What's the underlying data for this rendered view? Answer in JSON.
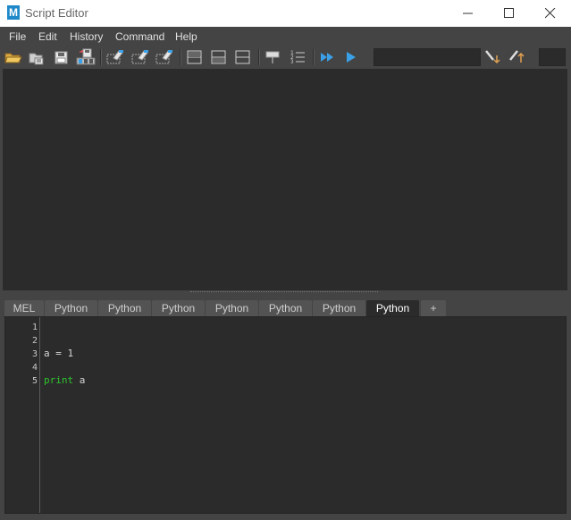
{
  "window": {
    "title": "Script Editor",
    "app_icon_letter": "M"
  },
  "menu": {
    "items": [
      "File",
      "Edit",
      "History",
      "Command",
      "Help"
    ]
  },
  "toolbar": {
    "icons": [
      "open-script-icon",
      "source-script-icon",
      "save-script-icon",
      "save-to-shelf-icon",
      "clear-history-icon",
      "clear-input-icon",
      "clear-all-icon",
      "show-history-only-icon",
      "show-input-only-icon",
      "show-both-icon",
      "echo-all-commands-icon",
      "show-line-numbers-icon",
      "execute-all-icon",
      "execute-icon",
      "search-down-icon",
      "search-up-icon"
    ],
    "command_value": "",
    "colors": {
      "accent": "#1e88c8",
      "play": "#3aa0e8",
      "search": "#e0a050"
    }
  },
  "tabs": [
    {
      "label": "MEL",
      "active": false
    },
    {
      "label": "Python",
      "active": false
    },
    {
      "label": "Python",
      "active": false
    },
    {
      "label": "Python",
      "active": false
    },
    {
      "label": "Python",
      "active": false
    },
    {
      "label": "Python",
      "active": false
    },
    {
      "label": "Python",
      "active": false
    },
    {
      "label": "Python",
      "active": true
    },
    {
      "label": "+",
      "active": false
    }
  ],
  "editor": {
    "line_numbers": [
      "1",
      "2",
      "3",
      "4",
      "5"
    ],
    "lines": [
      {
        "keyword": "",
        "text": ""
      },
      {
        "keyword": "",
        "text": ""
      },
      {
        "keyword": "",
        "text": "a = 1"
      },
      {
        "keyword": "",
        "text": ""
      },
      {
        "keyword": "print",
        "text": " a"
      }
    ],
    "colors": {
      "keyword": "#2ec62e",
      "background": "#2b2b2b"
    }
  }
}
